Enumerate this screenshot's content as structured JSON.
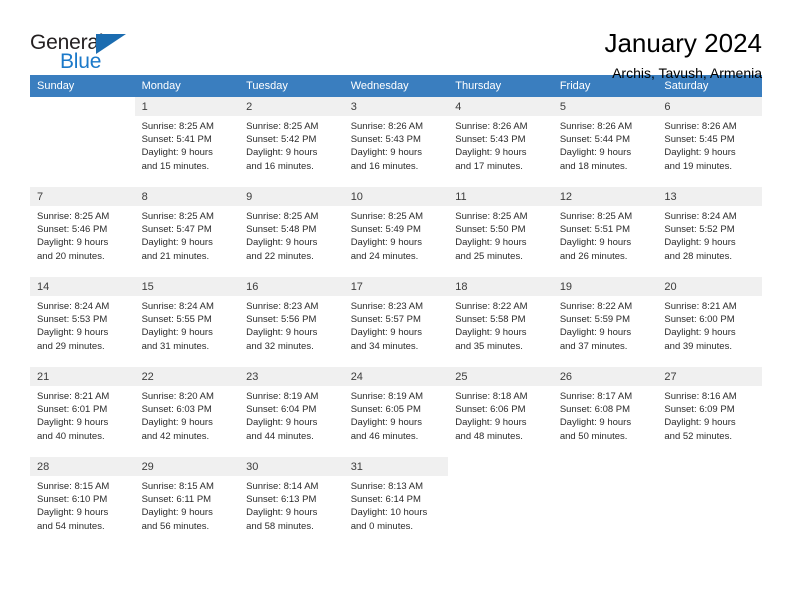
{
  "brand": {
    "name_part1": "General",
    "name_part2": "Blue",
    "triangle_icon": "triangle-icon",
    "accent_color": "#1b79c9"
  },
  "header": {
    "title": "January 2024",
    "subtitle": "Archis, Tavush, Armenia"
  },
  "theme": {
    "header_bg": "#3a7ebf",
    "daynum_bg": "#f0f0f0",
    "text_color": "#2b2b2b"
  },
  "calendar": {
    "weekday_headers": [
      "Sunday",
      "Monday",
      "Tuesday",
      "Wednesday",
      "Thursday",
      "Friday",
      "Saturday"
    ],
    "weeks": [
      [
        {
          "day": "",
          "lines": []
        },
        {
          "day": "1",
          "lines": [
            "Sunrise: 8:25 AM",
            "Sunset: 5:41 PM",
            "Daylight: 9 hours",
            "and 15 minutes."
          ]
        },
        {
          "day": "2",
          "lines": [
            "Sunrise: 8:25 AM",
            "Sunset: 5:42 PM",
            "Daylight: 9 hours",
            "and 16 minutes."
          ]
        },
        {
          "day": "3",
          "lines": [
            "Sunrise: 8:26 AM",
            "Sunset: 5:43 PM",
            "Daylight: 9 hours",
            "and 16 minutes."
          ]
        },
        {
          "day": "4",
          "lines": [
            "Sunrise: 8:26 AM",
            "Sunset: 5:43 PM",
            "Daylight: 9 hours",
            "and 17 minutes."
          ]
        },
        {
          "day": "5",
          "lines": [
            "Sunrise: 8:26 AM",
            "Sunset: 5:44 PM",
            "Daylight: 9 hours",
            "and 18 minutes."
          ]
        },
        {
          "day": "6",
          "lines": [
            "Sunrise: 8:26 AM",
            "Sunset: 5:45 PM",
            "Daylight: 9 hours",
            "and 19 minutes."
          ]
        }
      ],
      [
        {
          "day": "7",
          "lines": [
            "Sunrise: 8:25 AM",
            "Sunset: 5:46 PM",
            "Daylight: 9 hours",
            "and 20 minutes."
          ]
        },
        {
          "day": "8",
          "lines": [
            "Sunrise: 8:25 AM",
            "Sunset: 5:47 PM",
            "Daylight: 9 hours",
            "and 21 minutes."
          ]
        },
        {
          "day": "9",
          "lines": [
            "Sunrise: 8:25 AM",
            "Sunset: 5:48 PM",
            "Daylight: 9 hours",
            "and 22 minutes."
          ]
        },
        {
          "day": "10",
          "lines": [
            "Sunrise: 8:25 AM",
            "Sunset: 5:49 PM",
            "Daylight: 9 hours",
            "and 24 minutes."
          ]
        },
        {
          "day": "11",
          "lines": [
            "Sunrise: 8:25 AM",
            "Sunset: 5:50 PM",
            "Daylight: 9 hours",
            "and 25 minutes."
          ]
        },
        {
          "day": "12",
          "lines": [
            "Sunrise: 8:25 AM",
            "Sunset: 5:51 PM",
            "Daylight: 9 hours",
            "and 26 minutes."
          ]
        },
        {
          "day": "13",
          "lines": [
            "Sunrise: 8:24 AM",
            "Sunset: 5:52 PM",
            "Daylight: 9 hours",
            "and 28 minutes."
          ]
        }
      ],
      [
        {
          "day": "14",
          "lines": [
            "Sunrise: 8:24 AM",
            "Sunset: 5:53 PM",
            "Daylight: 9 hours",
            "and 29 minutes."
          ]
        },
        {
          "day": "15",
          "lines": [
            "Sunrise: 8:24 AM",
            "Sunset: 5:55 PM",
            "Daylight: 9 hours",
            "and 31 minutes."
          ]
        },
        {
          "day": "16",
          "lines": [
            "Sunrise: 8:23 AM",
            "Sunset: 5:56 PM",
            "Daylight: 9 hours",
            "and 32 minutes."
          ]
        },
        {
          "day": "17",
          "lines": [
            "Sunrise: 8:23 AM",
            "Sunset: 5:57 PM",
            "Daylight: 9 hours",
            "and 34 minutes."
          ]
        },
        {
          "day": "18",
          "lines": [
            "Sunrise: 8:22 AM",
            "Sunset: 5:58 PM",
            "Daylight: 9 hours",
            "and 35 minutes."
          ]
        },
        {
          "day": "19",
          "lines": [
            "Sunrise: 8:22 AM",
            "Sunset: 5:59 PM",
            "Daylight: 9 hours",
            "and 37 minutes."
          ]
        },
        {
          "day": "20",
          "lines": [
            "Sunrise: 8:21 AM",
            "Sunset: 6:00 PM",
            "Daylight: 9 hours",
            "and 39 minutes."
          ]
        }
      ],
      [
        {
          "day": "21",
          "lines": [
            "Sunrise: 8:21 AM",
            "Sunset: 6:01 PM",
            "Daylight: 9 hours",
            "and 40 minutes."
          ]
        },
        {
          "day": "22",
          "lines": [
            "Sunrise: 8:20 AM",
            "Sunset: 6:03 PM",
            "Daylight: 9 hours",
            "and 42 minutes."
          ]
        },
        {
          "day": "23",
          "lines": [
            "Sunrise: 8:19 AM",
            "Sunset: 6:04 PM",
            "Daylight: 9 hours",
            "and 44 minutes."
          ]
        },
        {
          "day": "24",
          "lines": [
            "Sunrise: 8:19 AM",
            "Sunset: 6:05 PM",
            "Daylight: 9 hours",
            "and 46 minutes."
          ]
        },
        {
          "day": "25",
          "lines": [
            "Sunrise: 8:18 AM",
            "Sunset: 6:06 PM",
            "Daylight: 9 hours",
            "and 48 minutes."
          ]
        },
        {
          "day": "26",
          "lines": [
            "Sunrise: 8:17 AM",
            "Sunset: 6:08 PM",
            "Daylight: 9 hours",
            "and 50 minutes."
          ]
        },
        {
          "day": "27",
          "lines": [
            "Sunrise: 8:16 AM",
            "Sunset: 6:09 PM",
            "Daylight: 9 hours",
            "and 52 minutes."
          ]
        }
      ],
      [
        {
          "day": "28",
          "lines": [
            "Sunrise: 8:15 AM",
            "Sunset: 6:10 PM",
            "Daylight: 9 hours",
            "and 54 minutes."
          ]
        },
        {
          "day": "29",
          "lines": [
            "Sunrise: 8:15 AM",
            "Sunset: 6:11 PM",
            "Daylight: 9 hours",
            "and 56 minutes."
          ]
        },
        {
          "day": "30",
          "lines": [
            "Sunrise: 8:14 AM",
            "Sunset: 6:13 PM",
            "Daylight: 9 hours",
            "and 58 minutes."
          ]
        },
        {
          "day": "31",
          "lines": [
            "Sunrise: 8:13 AM",
            "Sunset: 6:14 PM",
            "Daylight: 10 hours",
            "and 0 minutes."
          ]
        },
        {
          "day": "",
          "lines": []
        },
        {
          "day": "",
          "lines": []
        },
        {
          "day": "",
          "lines": []
        }
      ]
    ]
  }
}
